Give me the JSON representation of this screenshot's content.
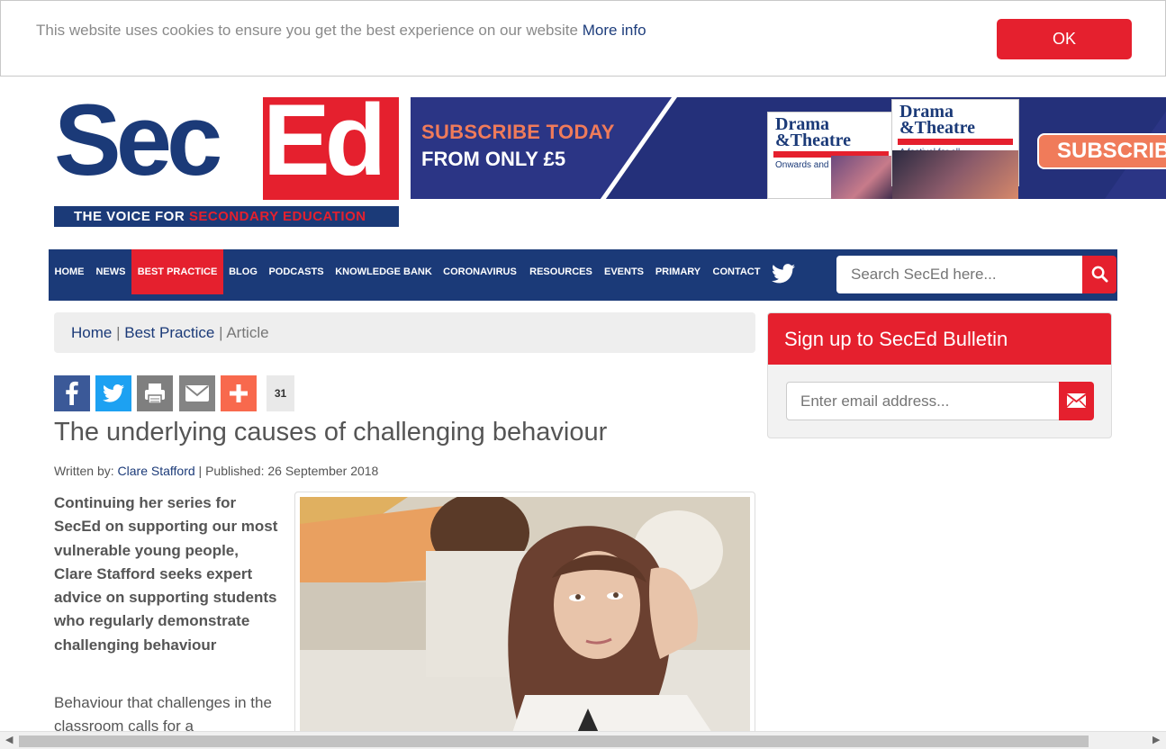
{
  "cookie": {
    "text": "This website uses cookies to ensure you get the best experience on our website",
    "link": "More info",
    "ok": "OK"
  },
  "logo": {
    "sec": "Sec",
    "ed": "Ed",
    "tagline_a": "THE VOICE FOR ",
    "tagline_b": "SECONDARY EDUCATION"
  },
  "banner": {
    "line1": "SUBSCRIBE TODAY",
    "line2": "FROM ONLY £5",
    "mag1_title": "Drama",
    "mag1_title2": "&Theatre",
    "mag1_sub": "Onwards and upwards",
    "mag2_title": "Drama",
    "mag2_title2": "&Theatre",
    "mag2_sub": "A festival for all",
    "button": "SUBSCRIBE"
  },
  "nav": {
    "items": [
      "HOME",
      "NEWS",
      "BEST PRACTICE",
      "BLOG",
      "PODCASTS",
      "KNOWLEDGE BANK",
      "CORONAVIRUS",
      "RESOURCES",
      "EVENTS",
      "PRIMARY",
      "CONTACT"
    ],
    "active": "BEST PRACTICE",
    "search_placeholder": "Search SecEd here..."
  },
  "breadcrumb": {
    "home": "Home",
    "sep1": " | ",
    "section": "Best Practice",
    "sep2": " | ",
    "current": "Article"
  },
  "share": {
    "count": "31"
  },
  "article": {
    "title": "The underlying causes of challenging behaviour",
    "written_by": "Written by: ",
    "author": "Clare Stafford",
    "published": " | Published: 26 September 2018",
    "intro": "Continuing her series for SecEd on supporting our most vulnerable young people, Clare Stafford seeks expert advice on supporting students who regularly demonstrate challenging behaviour",
    "body": "Behaviour that challenges in the classroom calls for a"
  },
  "signup": {
    "heading": "Sign up to SecEd Bulletin",
    "email_placeholder": "Enter email address..."
  },
  "colors": {
    "brand_navy": "#1b3a78",
    "brand_red": "#e5202e"
  }
}
